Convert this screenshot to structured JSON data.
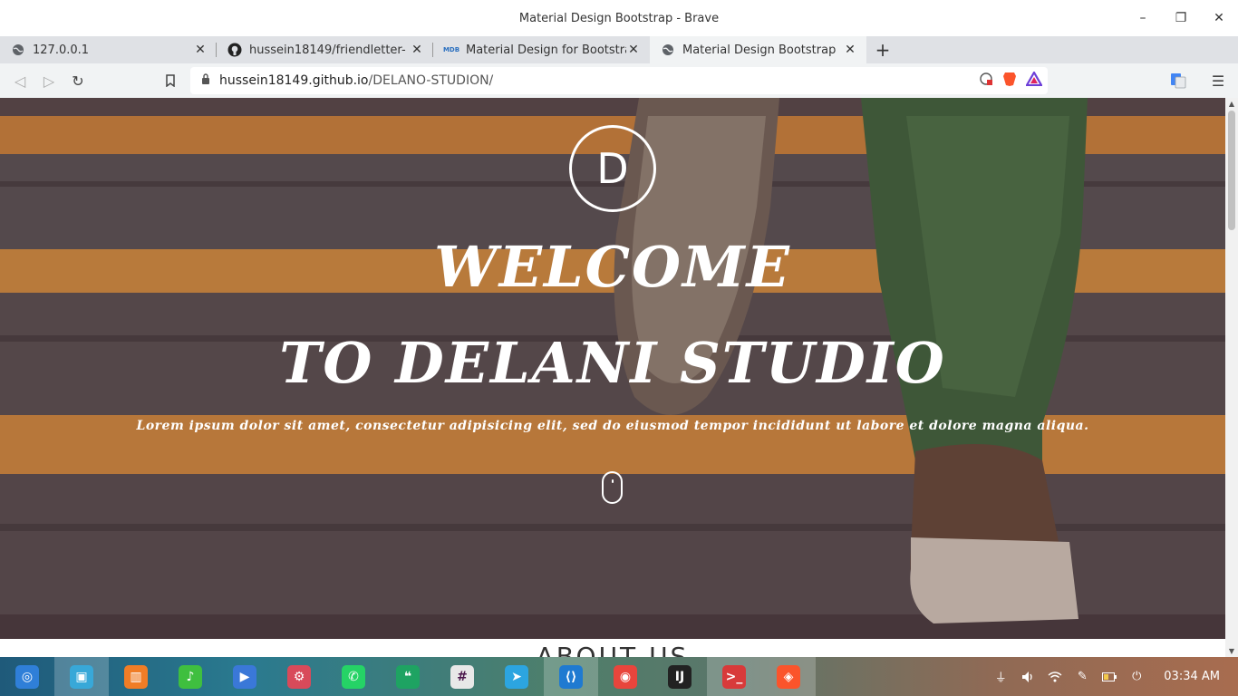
{
  "window": {
    "title": "Material Design Bootstrap - Brave",
    "minimize": "–",
    "maximize": "❐",
    "close": "✕"
  },
  "tabs": [
    {
      "title": "127.0.0.1",
      "icon": "globe-icon",
      "close": "✕"
    },
    {
      "title": "hussein18149/friendletter-",
      "icon": "github-icon",
      "close": "✕"
    },
    {
      "title": "Material Design for Bootstrap",
      "icon": "mdb-icon",
      "icon_text": "MDB",
      "close": "✕"
    },
    {
      "title": "Material Design Bootstrap",
      "icon": "globe-icon",
      "close": "✕",
      "active": true
    }
  ],
  "new_tab": "+",
  "toolbar": {
    "back": "◁",
    "forward": "▷",
    "reload": "↻",
    "url_host": "hussein18149.github.io",
    "url_path": "/DELANO-STUDION/",
    "menu": "☰"
  },
  "page": {
    "logo_letter": "D",
    "heading_line1": "WELCOME",
    "heading_line2": "TO DELANI STUDIO",
    "lead": "Lorem ipsum dolor sit amet, consectetur adipisicing elit, sed do eiusmod tempor incididunt ut labore et dolore magna aliqua.",
    "next_section": "ABOUT US"
  },
  "taskbar": {
    "apps": [
      {
        "name": "deepin-launcher-icon",
        "color": "#2f7fd8",
        "glyph": "◎"
      },
      {
        "name": "file-manager-icon",
        "color": "#38a8d8",
        "glyph": "▣",
        "active": true
      },
      {
        "name": "app-store-icon",
        "color": "#f07d26",
        "glyph": "▥"
      },
      {
        "name": "music-icon",
        "color": "#3fbf3f",
        "glyph": "♪"
      },
      {
        "name": "video-player-icon",
        "color": "#3a78d8",
        "glyph": "▶"
      },
      {
        "name": "settings-icon",
        "color": "#d84a5a",
        "glyph": "⚙"
      },
      {
        "name": "whatsapp-icon",
        "color": "#25d366",
        "glyph": "✆"
      },
      {
        "name": "hangouts-icon",
        "color": "#1ea362",
        "glyph": "❝"
      },
      {
        "name": "slack-icon",
        "color": "#e8e8e8",
        "glyph": "#"
      },
      {
        "name": "telegram-icon",
        "color": "#2ca5e0",
        "glyph": "➤"
      },
      {
        "name": "vscode-icon",
        "color": "#1f7ad1",
        "glyph": "⟨⟩",
        "active": true
      },
      {
        "name": "chrome-icon",
        "color": "#e8453c",
        "glyph": "◉"
      },
      {
        "name": "intellij-icon",
        "color": "#222222",
        "glyph": "IJ"
      },
      {
        "name": "terminal-icon",
        "color": "#d83a3a",
        "glyph": ">_",
        "active": true
      },
      {
        "name": "brave-icon",
        "color": "#fb542b",
        "glyph": "◈",
        "active": true
      }
    ],
    "clock": "03:34 AM"
  },
  "colors": {
    "stripe_orange": "#f0a030",
    "overlay": "#3c2832",
    "titlebar_bg": "#ffffff",
    "tabstrip_bg": "#dfe1e5",
    "toolbar_bg": "#f1f3f4"
  }
}
